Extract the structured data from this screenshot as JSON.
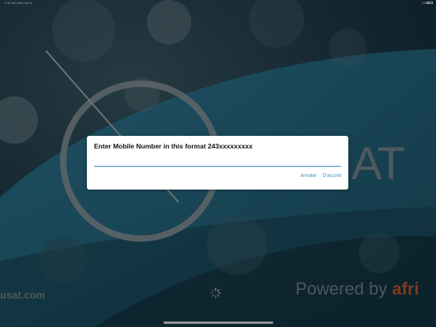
{
  "status_bar": {
    "left_text": "9:41 AM  Mon Jun 8",
    "right_text": "100%"
  },
  "background": {
    "brand_suffix": "AT",
    "site_url": "usat.com",
    "powered_by_text": "Powered by ",
    "powered_by_brand": "afri"
  },
  "dialog": {
    "title": "Enter Mobile Number in this format 243xxxxxxxxx",
    "input_value": "",
    "input_placeholder": "",
    "cancel_label": "Annuler",
    "ok_label": "D'accord"
  },
  "colors": {
    "accent": "#2f8fc9",
    "background_dark": "#0c1e27",
    "background_wave": "#1a4a5c",
    "brand_orange": "#7a3a1b"
  },
  "icons": {
    "spinner": "spinner-icon",
    "battery": "battery-icon"
  }
}
